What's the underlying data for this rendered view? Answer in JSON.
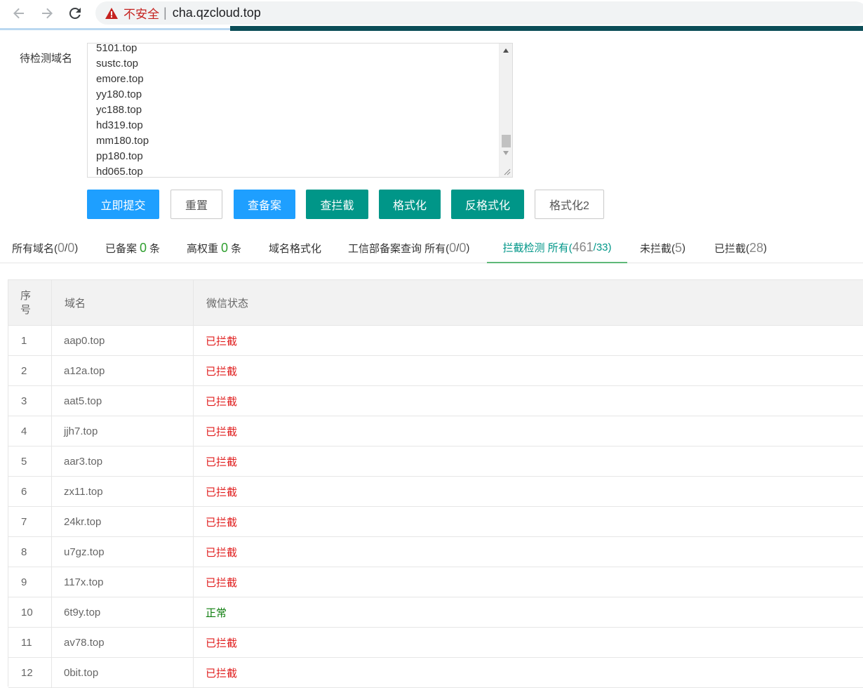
{
  "browser": {
    "insecure_label": "不安全",
    "separator": "|",
    "url": "cha.qzcloud.top"
  },
  "form": {
    "label": "待检测域名",
    "textarea_lines": [
      "5101.top",
      "sustc.top",
      "emore.top",
      "yy180.top",
      "yc188.top",
      "hd319.top",
      "mm180.top",
      "pp180.top",
      "hd065.top"
    ]
  },
  "buttons": {
    "submit": "立即提交",
    "reset": "重置",
    "check_icp": "查备案",
    "check_block": "查拦截",
    "format": "格式化",
    "unformat": "反格式化",
    "format2": "格式化2"
  },
  "tabs": {
    "all_domains": {
      "label": "所有域名(",
      "count": "0",
      "sep": "/",
      "total": "0",
      "close": ")"
    },
    "icp": {
      "label": "已备案",
      "count": "0",
      "unit": "条"
    },
    "high_weight": {
      "label": "高权重",
      "count": "0",
      "unit": "条"
    },
    "domain_format": {
      "label": "域名格式化"
    },
    "miit": {
      "label": "工信部备案查询 所有(",
      "count": "0",
      "sep": "/",
      "total": "0",
      "close": ")"
    },
    "block_check": {
      "label": "拦截检测 所有(",
      "count": "461",
      "sep": "/",
      "total": "33",
      "close": ")"
    },
    "not_blocked": {
      "label": "未拦截(",
      "count": "5",
      "close": ")"
    },
    "blocked": {
      "label": "已拦截(",
      "count": "28",
      "close": ")"
    }
  },
  "table": {
    "headers": {
      "index_line1": "序",
      "index_line2": "号",
      "domain": "域名",
      "wechat_status": "微信状态"
    },
    "rows": [
      {
        "index": "1",
        "domain": "aap0.top",
        "status": "已拦截",
        "blocked": true
      },
      {
        "index": "2",
        "domain": "a12a.top",
        "status": "已拦截",
        "blocked": true
      },
      {
        "index": "3",
        "domain": "aat5.top",
        "status": "已拦截",
        "blocked": true
      },
      {
        "index": "4",
        "domain": "jjh7.top",
        "status": "已拦截",
        "blocked": true
      },
      {
        "index": "5",
        "domain": "aar3.top",
        "status": "已拦截",
        "blocked": true
      },
      {
        "index": "6",
        "domain": "zx11.top",
        "status": "已拦截",
        "blocked": true
      },
      {
        "index": "7",
        "domain": "24kr.top",
        "status": "已拦截",
        "blocked": true
      },
      {
        "index": "8",
        "domain": "u7gz.top",
        "status": "已拦截",
        "blocked": true
      },
      {
        "index": "9",
        "domain": "117x.top",
        "status": "已拦截",
        "blocked": true
      },
      {
        "index": "10",
        "domain": "6t9y.top",
        "status": "正常",
        "blocked": false
      },
      {
        "index": "11",
        "domain": "av78.top",
        "status": "已拦截",
        "blocked": true
      },
      {
        "index": "12",
        "domain": "0bit.top",
        "status": "已拦截",
        "blocked": true
      }
    ]
  },
  "colors": {
    "blocked": "#e01c1c",
    "normal": "#0d7d0d",
    "button_blue": "#1e9fff",
    "button_teal": "#009688",
    "active_tab": "#009688"
  }
}
